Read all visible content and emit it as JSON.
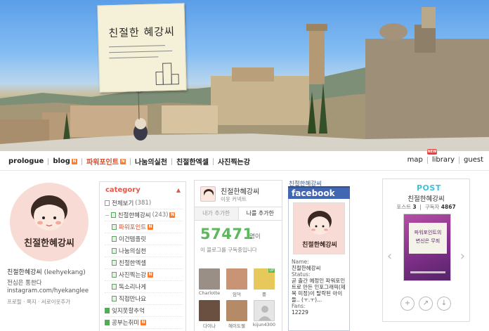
{
  "banner": {
    "note_title": "친절한 혜강씨"
  },
  "nav": {
    "left": [
      {
        "label": "prologue"
      },
      {
        "label": "blog"
      },
      {
        "label": "파워포인트"
      },
      {
        "label": "나눔의실천"
      },
      {
        "label": "친절한엑셀"
      },
      {
        "label": "사진찍는강"
      }
    ],
    "right": [
      {
        "label": "map"
      },
      {
        "label": "library"
      },
      {
        "label": "guest"
      }
    ],
    "new_badge": "NEW",
    "n_badge": "N"
  },
  "profile": {
    "name": "친절한혜강씨",
    "id": "(leehyekang)",
    "desc": "전심은 통한다 instagram.com/hyekanglee",
    "links": "프로필 · 쪽지 · 서로이웃추가"
  },
  "category": {
    "heading": "category",
    "collapse_icon": "▲",
    "all": "전체보기",
    "all_count": "(381)",
    "group": "친절한혜강씨",
    "group_count": "(243)",
    "items": [
      {
        "label": "파워포인트",
        "new": true
      },
      {
        "label": "이건템플릿",
        "new": false
      },
      {
        "label": "나눔의실천",
        "new": false
      },
      {
        "label": "친절한엑셀",
        "new": false
      },
      {
        "label": "사진찍는강",
        "new": true
      },
      {
        "label": "독소리나게",
        "new": false
      },
      {
        "label": "직접만나요",
        "new": false
      }
    ],
    "after": [
      {
        "label": "잊지못할추억",
        "new": false
      },
      {
        "label": "공부는취미",
        "new": true
      }
    ]
  },
  "neighbor": {
    "title": "친절한혜강씨",
    "subtitle": "이웃 커넥트",
    "tab1": "내가 추가한",
    "tab2": "나를 추가한",
    "count": "57471",
    "unit": "명이",
    "desc": "이 블로그를 구독중입니다",
    "up_tag": "UP",
    "people": [
      {
        "name": "Charlotte",
        "color": "#9a8f86"
      },
      {
        "name": "임덕",
        "color": "#c99476"
      },
      {
        "name": "뿅",
        "color": "#e7c95b"
      },
      {
        "name": "다이나",
        "color": "#6a5040"
      },
      {
        "name": "헤이도젤",
        "color": "#b58a67"
      },
      {
        "name": "kijun4300",
        "color": "#e6e6e6"
      }
    ]
  },
  "facebook": {
    "top_label": "친절한혜강씨",
    "brand": "facebook",
    "name_label": "Name:",
    "name": "친절한혜강씨",
    "status_label": "Status:",
    "status": "곧 출간 예정인 파워포인트로 만든 인포그래픽(제목 미정)이 탈락된 아이들.. (ㅜ.ㅜ)...",
    "fans_label": "Fans:",
    "fans": "12229"
  },
  "post": {
    "logo": "POST",
    "title": "친절한혜강씨",
    "posts_label": "포스트",
    "posts": "3",
    "subs_label": "구독자",
    "subs": "4867",
    "cover_line1": "파워포인트의",
    "cover_line2": "변신은 무죄",
    "prev": "‹",
    "next": "›",
    "actions": [
      "+",
      "↗",
      "↓"
    ]
  },
  "colors": {
    "accent_red": "#d24a2a",
    "neighbor_green": "#5cb85c",
    "facebook_blue": "#4267b2",
    "post_cyan": "#3cc3d9"
  }
}
